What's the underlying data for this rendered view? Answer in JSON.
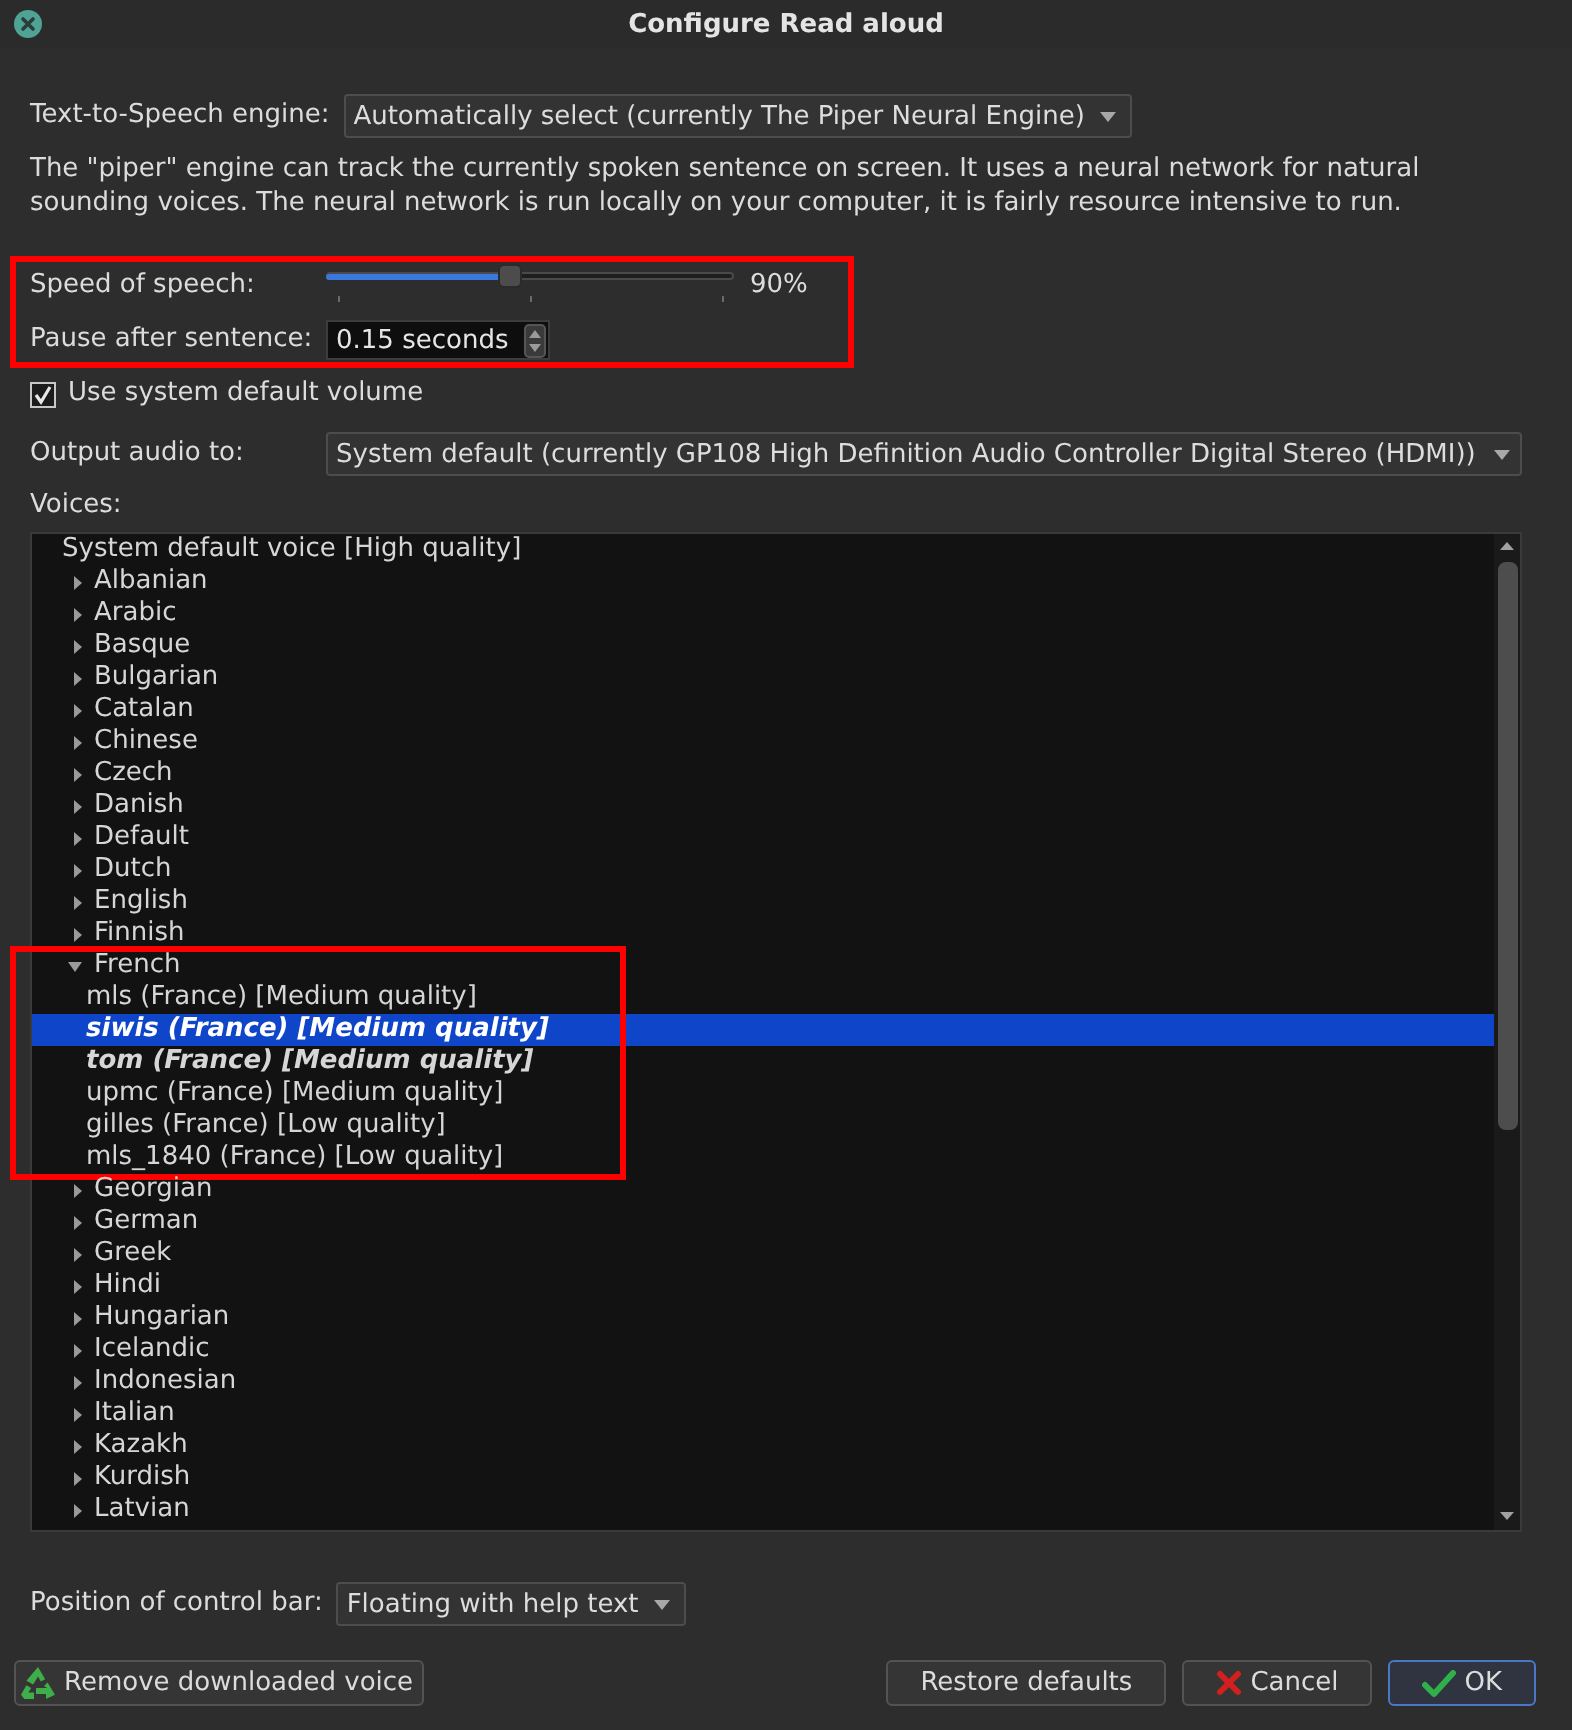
{
  "window": {
    "title": "Configure Read aloud"
  },
  "engine": {
    "label": "Text-to-Speech engine:",
    "value": "Automatically select (currently The Piper Neural Engine)"
  },
  "description": "The \"piper\" engine can track the currently spoken sentence on screen. It uses a neural network for natural sounding voices. The neural network is run locally on your computer, it is fairly resource intensive to run.",
  "speech": {
    "highlighted": true,
    "speed": {
      "label": "Speed of speech:",
      "level": 0.45,
      "reading": "90%"
    },
    "pause": {
      "label": "Pause after sentence:",
      "value": "0.15 seconds"
    }
  },
  "volume": {
    "label": "Use system default volume",
    "checked": true
  },
  "output": {
    "label": "Output audio to:",
    "value": "System default (currently GP108 High Definition Audio Controller Digital Stereo (HDMI))"
  },
  "voices": {
    "label": "Voices:",
    "items": [
      {
        "kind": "voice",
        "label": "System default voice [High quality]",
        "selected": false,
        "emphasized": false
      },
      {
        "kind": "language",
        "label": "Albanian",
        "expanded": false,
        "selected": false,
        "highlighted": false
      },
      {
        "kind": "language",
        "label": "Arabic",
        "expanded": false,
        "selected": false,
        "highlighted": false
      },
      {
        "kind": "language",
        "label": "Basque",
        "expanded": false,
        "selected": false,
        "highlighted": false
      },
      {
        "kind": "language",
        "label": "Bulgarian",
        "expanded": false,
        "selected": false,
        "highlighted": false
      },
      {
        "kind": "language",
        "label": "Catalan",
        "expanded": false,
        "selected": false,
        "highlighted": false
      },
      {
        "kind": "language",
        "label": "Chinese",
        "expanded": false,
        "selected": false,
        "highlighted": false
      },
      {
        "kind": "language",
        "label": "Czech",
        "expanded": false,
        "selected": false,
        "highlighted": false
      },
      {
        "kind": "language",
        "label": "Danish",
        "expanded": false,
        "selected": false,
        "highlighted": false
      },
      {
        "kind": "language",
        "label": "Default",
        "expanded": false,
        "selected": false,
        "highlighted": false
      },
      {
        "kind": "language",
        "label": "Dutch",
        "expanded": false,
        "selected": false,
        "highlighted": false
      },
      {
        "kind": "language",
        "label": "English",
        "expanded": false,
        "selected": false,
        "highlighted": false
      },
      {
        "kind": "language",
        "label": "Finnish",
        "expanded": false,
        "selected": false,
        "highlighted": false
      },
      {
        "kind": "language",
        "label": "French",
        "expanded": true,
        "selected": false,
        "highlighted": true,
        "children": [
          {
            "kind": "voice",
            "label": "mls (France) [Medium quality]",
            "selected": false,
            "emphasized": false
          },
          {
            "kind": "voice",
            "label": "siwis (France) [Medium quality]",
            "selected": true,
            "emphasized": true
          },
          {
            "kind": "voice",
            "label": "tom (France) [Medium quality]",
            "selected": false,
            "emphasized": true
          },
          {
            "kind": "voice",
            "label": "upmc (France) [Medium quality]",
            "selected": false,
            "emphasized": false
          },
          {
            "kind": "voice",
            "label": "gilles (France) [Low quality]",
            "selected": false,
            "emphasized": false
          },
          {
            "kind": "voice",
            "label": "mls_1840 (France) [Low quality]",
            "selected": false,
            "emphasized": false
          }
        ]
      },
      {
        "kind": "language",
        "label": "Georgian",
        "expanded": false,
        "selected": false,
        "highlighted": false
      },
      {
        "kind": "language",
        "label": "German",
        "expanded": false,
        "selected": false,
        "highlighted": false
      },
      {
        "kind": "language",
        "label": "Greek",
        "expanded": false,
        "selected": false,
        "highlighted": false
      },
      {
        "kind": "language",
        "label": "Hindi",
        "expanded": false,
        "selected": false,
        "highlighted": false
      },
      {
        "kind": "language",
        "label": "Hungarian",
        "expanded": false,
        "selected": false,
        "highlighted": false
      },
      {
        "kind": "language",
        "label": "Icelandic",
        "expanded": false,
        "selected": false,
        "highlighted": false
      },
      {
        "kind": "language",
        "label": "Indonesian",
        "expanded": false,
        "selected": false,
        "highlighted": false
      },
      {
        "kind": "language",
        "label": "Italian",
        "expanded": false,
        "selected": false,
        "highlighted": false
      },
      {
        "kind": "language",
        "label": "Kazakh",
        "expanded": false,
        "selected": false,
        "highlighted": false
      },
      {
        "kind": "language",
        "label": "Kurdish",
        "expanded": false,
        "selected": false,
        "highlighted": false
      },
      {
        "kind": "language",
        "label": "Latvian",
        "expanded": false,
        "selected": false,
        "highlighted": false
      }
    ]
  },
  "control_bar": {
    "label": "Position of control bar:",
    "value": "Floating with help text"
  },
  "remove_button": {
    "label": "Remove downloaded voice",
    "kind": "remove",
    "default": false
  },
  "buttons": [
    {
      "label": "Restore defaults",
      "kind": "restore",
      "default": false
    },
    {
      "label": "Cancel",
      "kind": "cancel",
      "default": false
    },
    {
      "label": "OK",
      "kind": "confirm",
      "default": true
    }
  ]
}
